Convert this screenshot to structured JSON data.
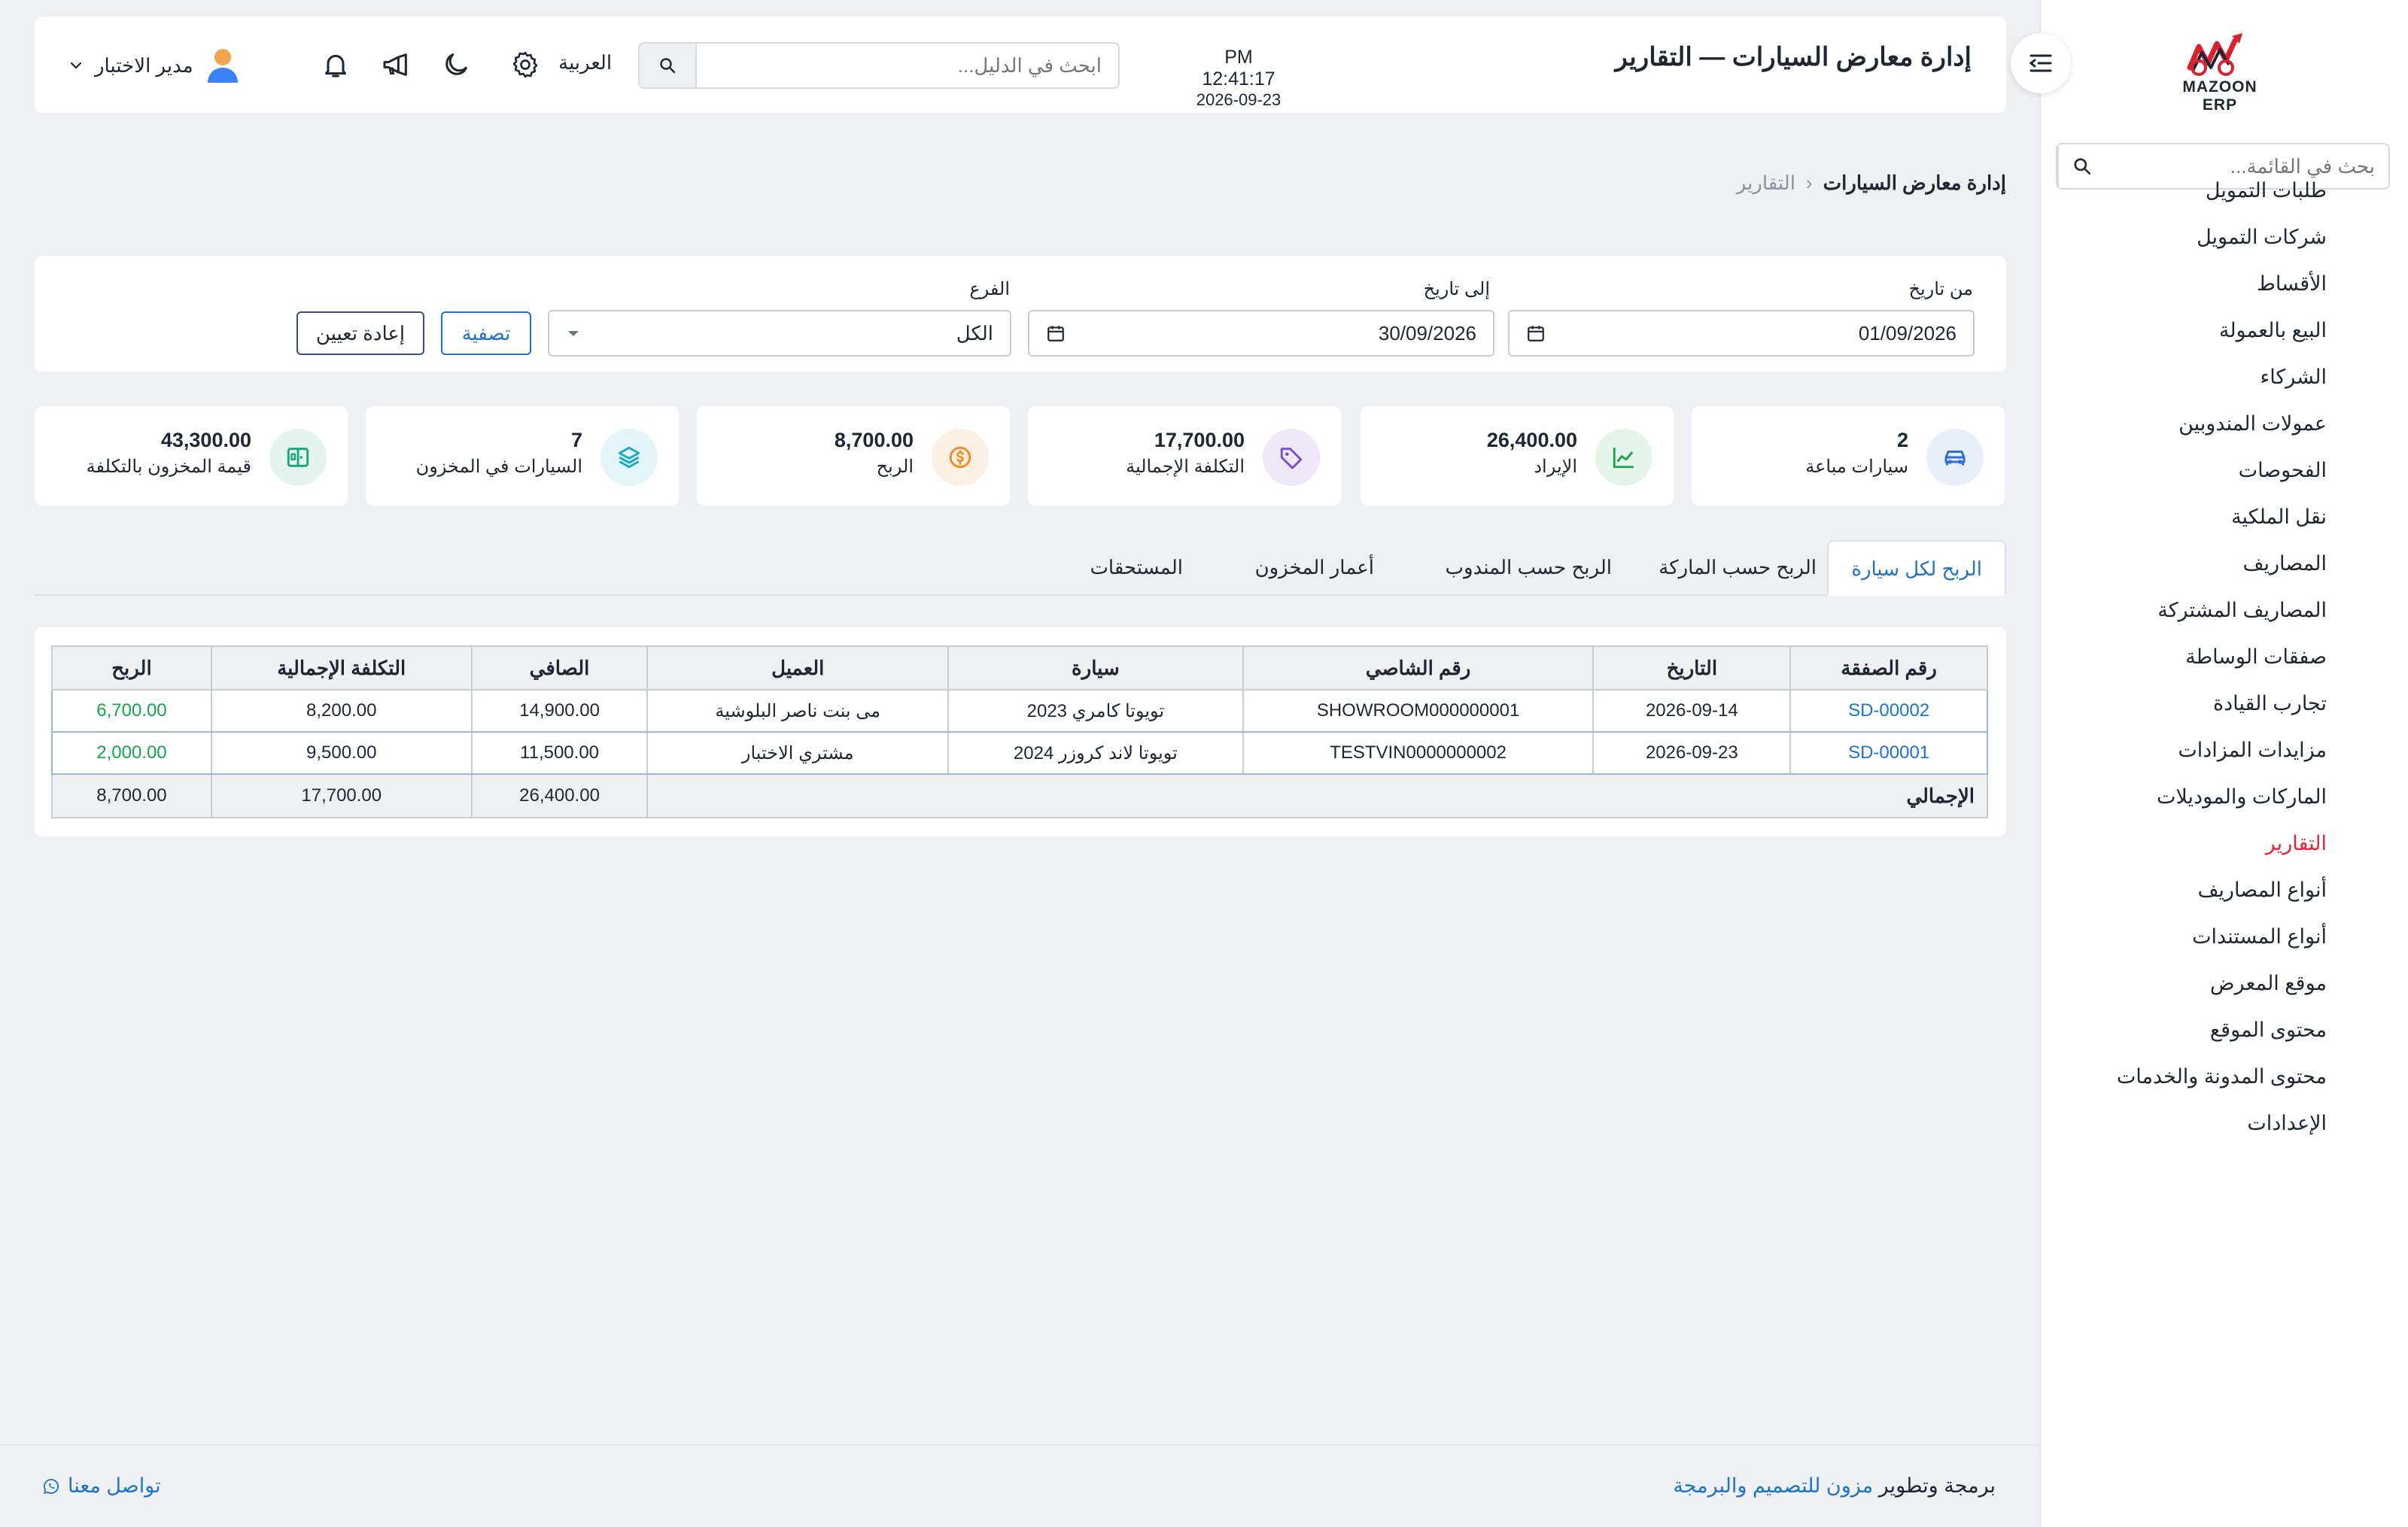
{
  "sidebar": {
    "logo_text": "MAZOON ERP",
    "search_placeholder": "بحث في القائمة...",
    "items": [
      {
        "label": "طلبات التمويل"
      },
      {
        "label": "شركات التمويل"
      },
      {
        "label": "الأقساط"
      },
      {
        "label": "البيع بالعمولة"
      },
      {
        "label": "الشركاء"
      },
      {
        "label": "عمولات المندوبين"
      },
      {
        "label": "الفحوصات"
      },
      {
        "label": "نقل الملكية"
      },
      {
        "label": "المصاريف"
      },
      {
        "label": "المصاريف المشتركة"
      },
      {
        "label": "صفقات الوساطة"
      },
      {
        "label": "تجارب القيادة"
      },
      {
        "label": "مزايدات المزادات"
      },
      {
        "label": "الماركات والموديلات"
      },
      {
        "label": "التقارير"
      },
      {
        "label": "أنواع المصاريف"
      },
      {
        "label": "أنواع المستندات"
      },
      {
        "label": "موقع المعرض"
      },
      {
        "label": "محتوى الموقع"
      },
      {
        "label": "محتوى المدونة والخدمات"
      },
      {
        "label": "الإعدادات"
      }
    ]
  },
  "header": {
    "title": "إدارة معارض السيارات — التقارير",
    "time": "PM 12:41:17",
    "date": "2026-09-23",
    "search_placeholder": "ابحث في الدليل...",
    "language": "العربية",
    "user_name": "مدير الاختبار"
  },
  "breadcrumb": {
    "root": "إدارة معارض السيارات",
    "current": "التقارير"
  },
  "filters": {
    "from_label": "من تاريخ",
    "from_value": "01/09/2026",
    "to_label": "إلى تاريخ",
    "to_value": "30/09/2026",
    "branch_label": "الفرع",
    "branch_value": "الكل",
    "filter_button": "تصفية",
    "reset_button": "إعادة تعيين"
  },
  "stats": [
    {
      "value": "2",
      "label": "سيارات مباعة",
      "icon": "car-icon",
      "color": "#2f6fd6",
      "bg": "#e7effb"
    },
    {
      "value": "26,400.00",
      "label": "الإيراد",
      "icon": "chart-line-icon",
      "color": "#17a44a",
      "bg": "#e5f5ea"
    },
    {
      "value": "17,700.00",
      "label": "التكلفة الإجمالية",
      "icon": "tag-icon",
      "color": "#7a4bd0",
      "bg": "#efe8fa"
    },
    {
      "value": "8,700.00",
      "label": "الربح",
      "icon": "coin-icon",
      "color": "#f08a1c",
      "bg": "#fdf0e2"
    },
    {
      "value": "7",
      "label": "السيارات في المخزون",
      "icon": "layers-icon",
      "color": "#16a8c6",
      "bg": "#e2f5f9"
    },
    {
      "value": "43,300.00",
      "label": "قيمة المخزون بالتكلفة",
      "icon": "warehouse-icon",
      "color": "#17a47a",
      "bg": "#e3f5ee"
    }
  ],
  "tabs": [
    {
      "label": "الربح لكل سيارة"
    },
    {
      "label": "الربح حسب الماركة"
    },
    {
      "label": "الربح حسب المندوب"
    },
    {
      "label": "أعمار المخزون"
    },
    {
      "label": "المستحقات"
    }
  ],
  "table": {
    "columns": [
      "رقم الصفقة",
      "التاريخ",
      "رقم الشاصي",
      "سيارة",
      "العميل",
      "الصافي",
      "التكلفة الإجمالية",
      "الربح"
    ],
    "rows": [
      [
        "SD-00002",
        "2026-09-14",
        "SHOWROOM000000001",
        "تويوتا كامري 2023",
        "مى بنت ناصر البلوشية",
        "14,900.00",
        "8,200.00",
        "6,700.00"
      ],
      [
        "SD-00001",
        "2026-09-23",
        "TESTVIN0000000002",
        "تويوتا لاند كروزر 2024",
        "مشتري الاختبار",
        "11,500.00",
        "9,500.00",
        "2,000.00"
      ]
    ],
    "total_label": "الإجمالي",
    "total_net": "26,400.00",
    "total_cost": "17,700.00",
    "total_profit": "8,700.00"
  },
  "footer": {
    "contact": "تواصل معنا",
    "credit_prefix": "برمجة وتطوير",
    "credit_brand": "مزون للتصميم والبرمجة"
  }
}
